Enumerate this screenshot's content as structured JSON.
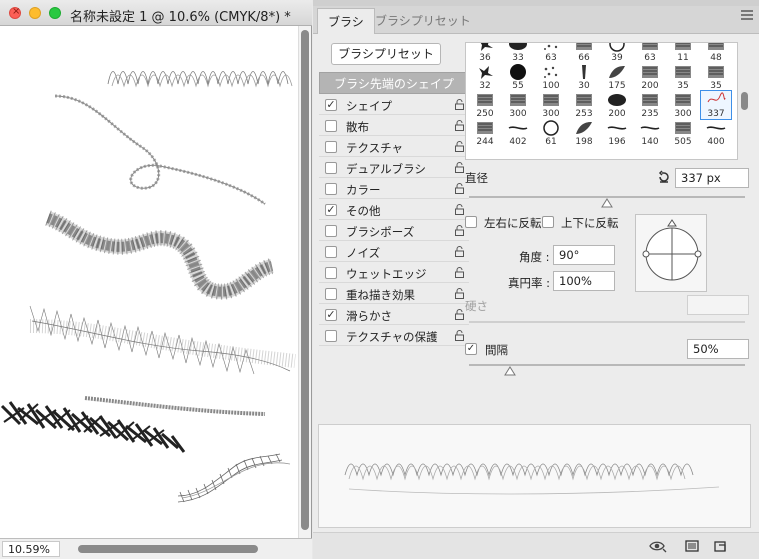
{
  "document": {
    "title": "名称未設定 1 @ 10.6% (CMYK/8*) *",
    "zoom": "10.59%"
  },
  "panel": {
    "tabs": [
      "ブラシ",
      "ブラシプリセット"
    ],
    "presets_button": "ブラシプリセット",
    "options_header": "ブラシ先端のシェイプ",
    "options": [
      {
        "label": "シェイプ",
        "checked": true
      },
      {
        "label": "散布",
        "checked": false
      },
      {
        "label": "テクスチャ",
        "checked": false
      },
      {
        "label": "デュアルブラシ",
        "checked": false
      },
      {
        "label": "カラー",
        "checked": false
      },
      {
        "label": "その他",
        "checked": true
      },
      {
        "label": "ブラシポーズ",
        "checked": false
      },
      {
        "label": "ノイズ",
        "checked": false
      },
      {
        "label": "ウェットエッジ",
        "checked": false
      },
      {
        "label": "重ね描き効果",
        "checked": false
      },
      {
        "label": "滑らかさ",
        "checked": true
      },
      {
        "label": "テクスチャの保護",
        "checked": false
      }
    ],
    "tips_rows": [
      [
        "36",
        "33",
        "63",
        "66",
        "39",
        "63",
        "11",
        "48"
      ],
      [
        "32",
        "55",
        "100",
        "30",
        "175",
        "200",
        "35",
        "35"
      ],
      [
        "250",
        "300",
        "300",
        "253",
        "200",
        "235",
        "300",
        "337"
      ],
      [
        "244",
        "402",
        "61",
        "198",
        "196",
        "140",
        "505",
        "400"
      ]
    ],
    "selected_tip": "337",
    "size": {
      "label": "直径",
      "value": "337 px",
      "fraction": 0.5
    },
    "flip_x": {
      "label": "左右に反転",
      "checked": false
    },
    "flip_y": {
      "label": "上下に反転",
      "checked": false
    },
    "angle": {
      "label": "角度 :",
      "value": "90°"
    },
    "roundness": {
      "label": "真円率 :",
      "value": "100%"
    },
    "hardness": {
      "label": "硬さ"
    },
    "spacing": {
      "label": "間隔",
      "value": "50%",
      "checked": true,
      "fraction": 0.15
    },
    "colors": {
      "accent": "#3d8fe8",
      "header": "#b4b4b4"
    }
  }
}
